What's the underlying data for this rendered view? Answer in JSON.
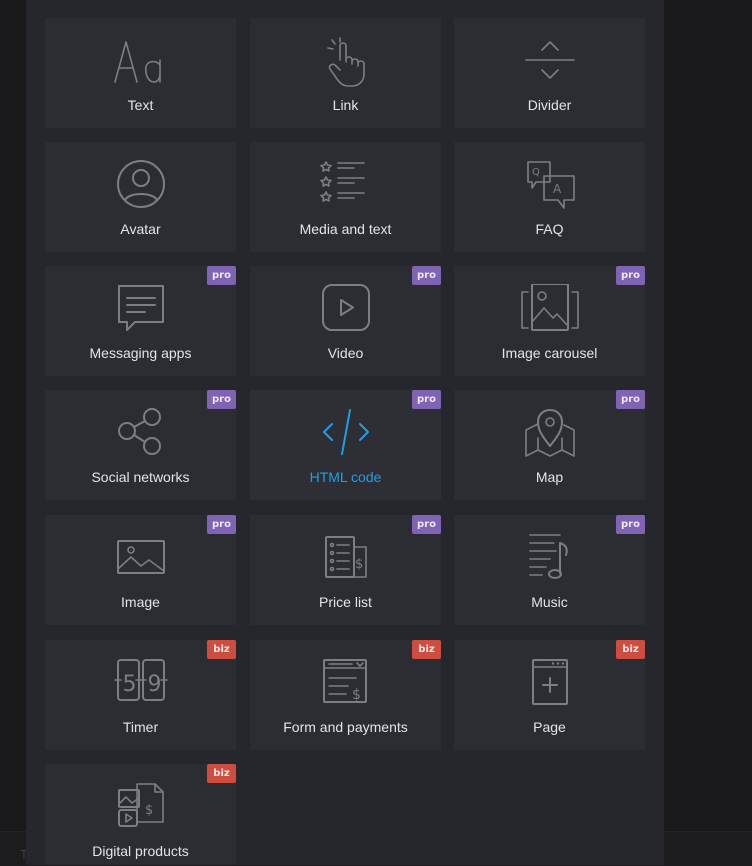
{
  "colors": {
    "panel_bg": "#26272c",
    "tile_bg": "#2c2d32",
    "icon_gray": "#7c7e86",
    "label_text": "#e4e4e8",
    "active_accent": "#1e9fe8",
    "pro_badge": "#7f64b4",
    "biz_badge": "#cf4d40"
  },
  "background": {
    "bottom_letter": "T"
  },
  "blocks": [
    {
      "label": "Text",
      "icon": "text-typography-icon",
      "badge": ""
    },
    {
      "label": "Link",
      "icon": "hand-pointer-icon",
      "badge": ""
    },
    {
      "label": "Divider",
      "icon": "divider-icon",
      "badge": ""
    },
    {
      "label": "Avatar",
      "icon": "avatar-icon",
      "badge": ""
    },
    {
      "label": "Media and text",
      "icon": "media-and-text-icon",
      "badge": ""
    },
    {
      "label": "FAQ",
      "icon": "faq-icon",
      "badge": ""
    },
    {
      "label": "Messaging apps",
      "icon": "chat-bubble-icon",
      "badge": "pro"
    },
    {
      "label": "Video",
      "icon": "play-video-icon",
      "badge": "pro"
    },
    {
      "label": "Image carousel",
      "icon": "image-carousel-icon",
      "badge": "pro"
    },
    {
      "label": "Social networks",
      "icon": "share-icon",
      "badge": "pro"
    },
    {
      "label": "HTML code",
      "icon": "code-icon",
      "badge": "pro",
      "active": true
    },
    {
      "label": "Map",
      "icon": "map-pin-icon",
      "badge": "pro"
    },
    {
      "label": "Image",
      "icon": "image-icon",
      "badge": "pro"
    },
    {
      "label": "Price list",
      "icon": "price-list-icon",
      "badge": "pro"
    },
    {
      "label": "Music",
      "icon": "music-icon",
      "badge": "pro"
    },
    {
      "label": "Timer",
      "icon": "timer-icon",
      "badge": "biz"
    },
    {
      "label": "Form and payments",
      "icon": "form-payment-icon",
      "badge": "biz"
    },
    {
      "label": "Page",
      "icon": "page-add-icon",
      "badge": "biz"
    },
    {
      "label": "Digital products",
      "icon": "digital-products-icon",
      "badge": "biz"
    }
  ]
}
